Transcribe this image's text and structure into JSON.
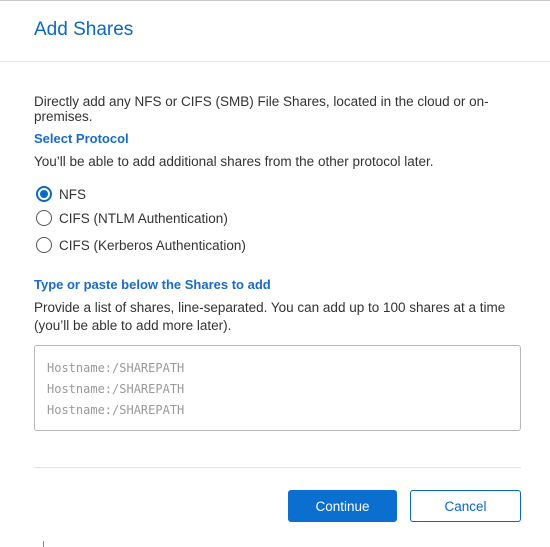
{
  "dialog": {
    "title": "Add Shares",
    "intro": "Directly add any NFS or CIFS (SMB) File Shares, located in the cloud or on-premises."
  },
  "protocol": {
    "heading": "Select Protocol",
    "help": "You’ll be able to add additional shares from the other protocol later.",
    "options": [
      {
        "label": "NFS",
        "checked": true
      },
      {
        "label": "CIFS (NTLM Authentication)",
        "checked": false
      },
      {
        "label": "CIFS (Kerberos Authentication)",
        "checked": false
      }
    ]
  },
  "shares": {
    "heading": "Type or paste below the Shares to add",
    "help": "Provide a list of shares, line-separated. You can add up to 100 shares at a time (you’ll be able to add more later).",
    "placeholder": "Hostname:/SHAREPATH\nHostname:/SHAREPATH\nHostname:/SHAREPATH",
    "placeholder_lines": [
      "Hostname:/SHAREPATH",
      "Hostname:/SHAREPATH",
      "Hostname:/SHAREPATH"
    ]
  },
  "footer": {
    "continue_label": "Continue",
    "cancel_label": "Cancel"
  },
  "colors": {
    "accent": "#0a69c7",
    "primary_button": "#0a6fcf",
    "placeholder_text": "#9a9a9a"
  }
}
